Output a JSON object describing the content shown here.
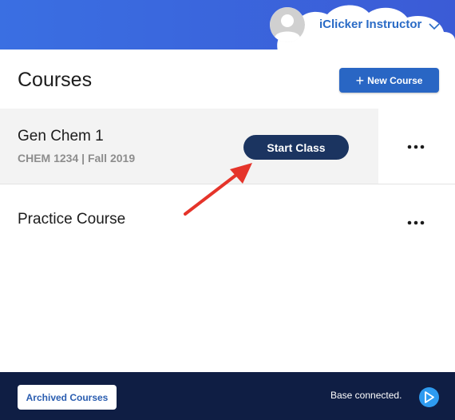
{
  "header": {
    "user_name": "iClicker Instructor"
  },
  "courses_page": {
    "title": "Courses",
    "new_course_label": "New Course",
    "new_course_icon": "plus-icon"
  },
  "courses": [
    {
      "name": "Gen Chem 1",
      "subtitle": "CHEM 1234 | Fall 2019",
      "action_label": "Start Class"
    },
    {
      "name": "Practice Course"
    }
  ],
  "footer": {
    "archived_label": "Archived Courses",
    "status": "Base connected.",
    "status_icon": "base-connected-icon"
  },
  "colors": {
    "header_blue": "#3d6fe0",
    "primary_button": "#2966c4",
    "start_class": "#1b3460",
    "footer": "#0f1e44",
    "annotation_arrow": "#e5342a",
    "status_icon": "#2e9bf0"
  }
}
